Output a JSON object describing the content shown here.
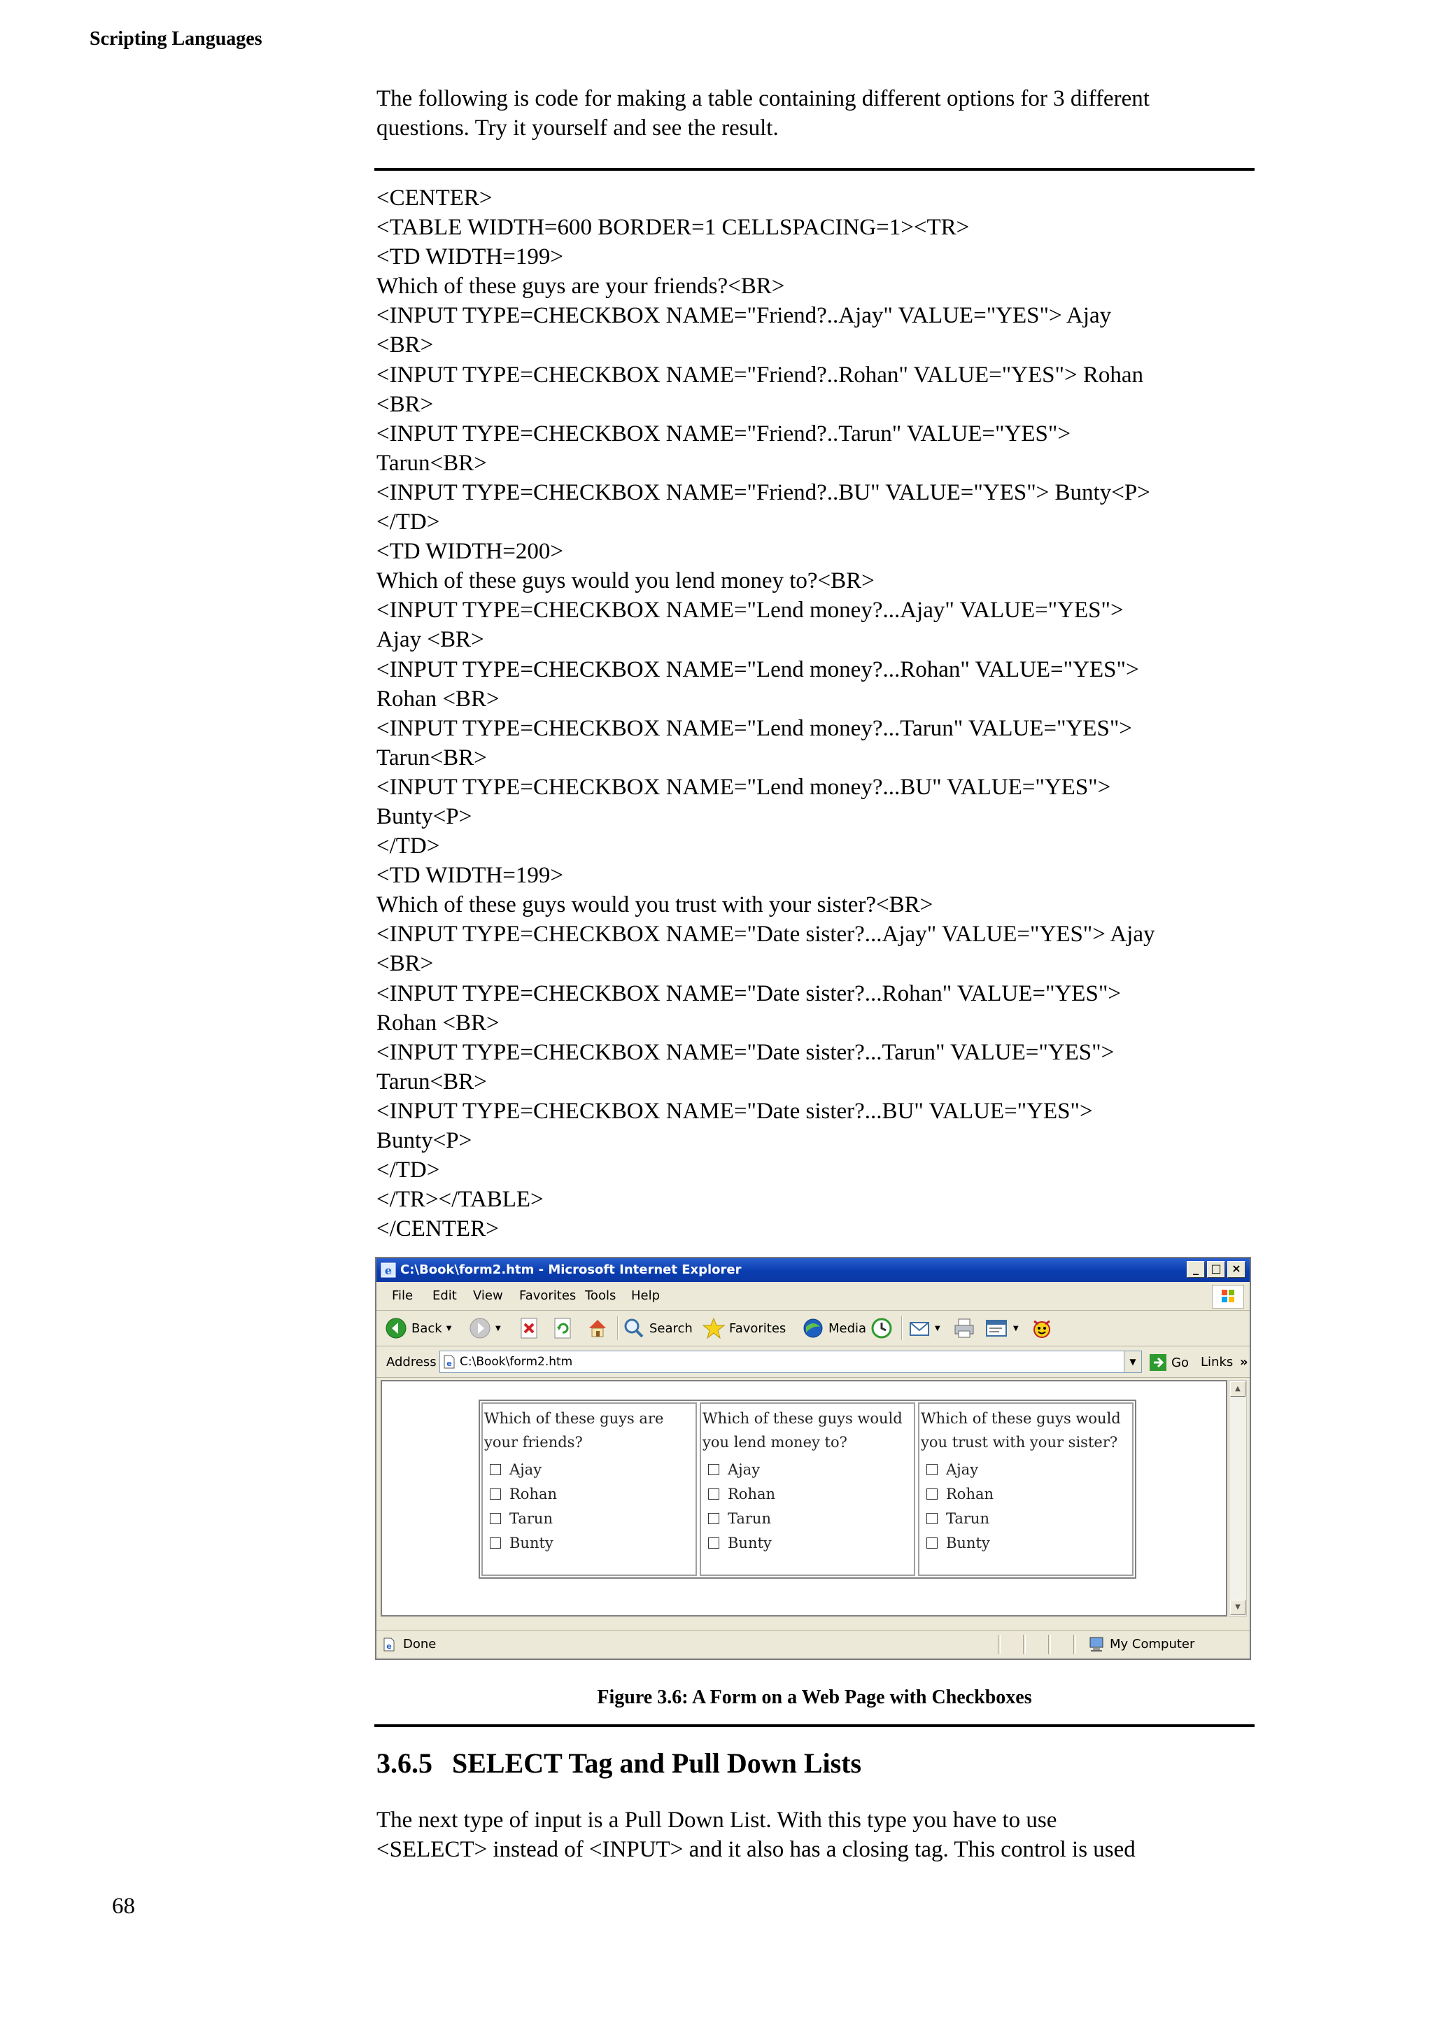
{
  "running_head": "Scripting Languages",
  "intro": "The following is code for making a table containing different options for 3 different questions. Try it yourself and see the result.",
  "code_lines": [
    "<CENTER>",
    "<TABLE WIDTH=600 BORDER=1 CELLSPACING=1><TR>",
    "<TD WIDTH=199>",
    "Which of these guys are your friends?<BR>",
    "<INPUT TYPE=CHECKBOX NAME=\"Friend?..Ajay\" VALUE=\"YES\"> Ajay",
    "<BR>",
    "<INPUT TYPE=CHECKBOX NAME=\"Friend?..Rohan\" VALUE=\"YES\"> Rohan",
    "<BR>",
    "<INPUT TYPE=CHECKBOX NAME=\"Friend?..Tarun\" VALUE=\"YES\">",
    "Tarun<BR>",
    "<INPUT TYPE=CHECKBOX NAME=\"Friend?..BU\" VALUE=\"YES\"> Bunty<P>",
    "</TD>",
    "<TD WIDTH=200>",
    "Which of these guys would you lend money to?<BR>",
    "<INPUT TYPE=CHECKBOX NAME=\"Lend money?...Ajay\" VALUE=\"YES\">",
    "Ajay <BR>",
    "<INPUT TYPE=CHECKBOX NAME=\"Lend money?...Rohan\" VALUE=\"YES\">",
    "Rohan <BR>",
    "<INPUT TYPE=CHECKBOX NAME=\"Lend money?...Tarun\" VALUE=\"YES\">",
    "Tarun<BR>",
    "<INPUT TYPE=CHECKBOX NAME=\"Lend money?...BU\" VALUE=\"YES\">",
    "Bunty<P>",
    "</TD>",
    "<TD WIDTH=199>",
    "Which of these guys would you trust with your sister?<BR>",
    "<INPUT TYPE=CHECKBOX NAME=\"Date sister?...Ajay\" VALUE=\"YES\"> Ajay",
    "<BR>",
    "<INPUT TYPE=CHECKBOX NAME=\"Date sister?...Rohan\" VALUE=\"YES\">",
    "Rohan <BR>",
    "<INPUT TYPE=CHECKBOX NAME=\"Date sister?...Tarun\" VALUE=\"YES\">",
    "Tarun<BR>",
    "<INPUT TYPE=CHECKBOX NAME=\"Date sister?...BU\" VALUE=\"YES\">",
    "Bunty<P>",
    "</TD>",
    "</TR></TABLE>",
    "</CENTER>"
  ],
  "browser": {
    "title": "C:\\Book\\form2.htm - Microsoft Internet Explorer",
    "menu": [
      "File",
      "Edit",
      "View",
      "Favorites",
      "Tools",
      "Help"
    ],
    "toolbar": {
      "back": "Back",
      "search": "Search",
      "favorites": "Favorites",
      "media": "Media"
    },
    "address_label": "Address",
    "address_value": "C:\\Book\\form2.htm",
    "go_label": "Go",
    "links_label": "Links",
    "links_more": "»",
    "status_text": "Done",
    "zone_text": "My Computer",
    "colors": {
      "title_bar": "#0a3db0",
      "chrome": "#ece9d8"
    }
  },
  "form": {
    "questions": [
      {
        "text": "Which of these guys are your friends?",
        "options": [
          "Ajay",
          "Rohan",
          "Tarun",
          "Bunty"
        ]
      },
      {
        "text": "Which of these guys would you lend money to?",
        "options": [
          "Ajay",
          "Rohan",
          "Tarun",
          "Bunty"
        ]
      },
      {
        "text": "Which of these guys would you trust with your sister?",
        "options": [
          "Ajay",
          "Rohan",
          "Tarun",
          "Bunty"
        ]
      }
    ]
  },
  "caption": "Figure 3.6: A Form on a Web Page with Checkboxes",
  "section": {
    "number": "3.6.5",
    "title": "SELECT Tag and Pull Down Lists"
  },
  "body_lines": [
    "The next type of input is a Pull Down List. With this type you have to use",
    "<SELECT> instead of <INPUT> and it also has a closing tag. This control is used"
  ],
  "page_number": "68"
}
